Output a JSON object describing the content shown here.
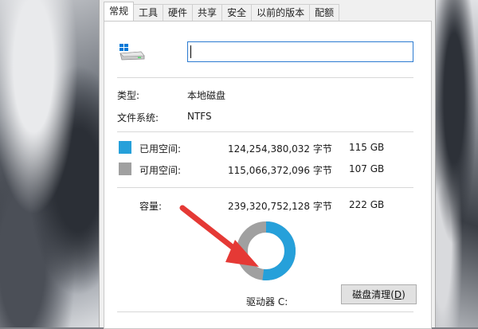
{
  "tabs": [
    "常规",
    "工具",
    "硬件",
    "共享",
    "安全",
    "以前的版本",
    "配额"
  ],
  "active_tab_index": 0,
  "drive_name_input": {
    "value": ""
  },
  "icons": {
    "drive": "windows-drive-icon"
  },
  "info": {
    "type_label": "类型:",
    "type_value": "本地磁盘",
    "fs_label": "文件系统:",
    "fs_value": "NTFS"
  },
  "used": {
    "label": "已用空间:",
    "bytes": "124,254,380,032 字节",
    "size": "115 GB",
    "color": "#26a0da"
  },
  "free": {
    "label": "可用空间:",
    "bytes": "115,066,372,096 字节",
    "size": "107 GB",
    "color": "#a0a0a0"
  },
  "capacity": {
    "label": "容量:",
    "bytes": "239,320,752,128 字节",
    "size": "222 GB"
  },
  "used_fraction": 0.519,
  "drive_label": "驱动器 C:",
  "cleanup_button": {
    "label": "磁盘清理(",
    "accel": "D",
    "close": ")"
  },
  "annotation_color": "#e53935"
}
